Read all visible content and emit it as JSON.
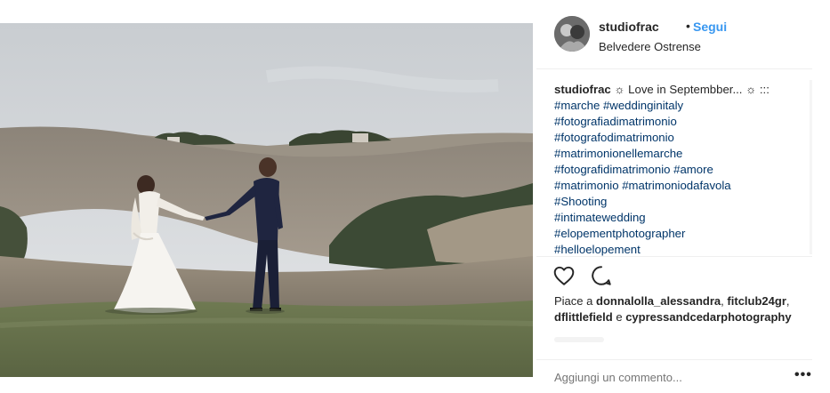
{
  "post": {
    "username": "studiofrac",
    "separator": "•",
    "follow_label": "Segui",
    "location": "Belvedere Ostrense"
  },
  "caption": {
    "user": "studiofrac",
    "first_line_text": "☼ Love in Septembber... ☼ :::",
    "lines": [
      "#marche #weddinginitaly",
      "#fotografiadimatrimonio",
      "#fotografodimatrimonio",
      "#matrimonionellemarche",
      "#fotografidimatrimonio #amore",
      "#matrimonio #matrimoniodafavola",
      "#Shooting",
      "#intimatewedding",
      "#elopementphotographer",
      "#helloelopement"
    ]
  },
  "likes": {
    "prefix": "Piace a",
    "user1": "donnalolla_alessandra",
    "comma": ",",
    "user2": "fitclub24gr",
    "user3": "dflittlefield",
    "conj": "e",
    "user4": "cypressandcedarphotography"
  },
  "comment": {
    "placeholder": "Aggiungi un commento...",
    "more_label": "•••"
  },
  "icons": {
    "like": "heart-icon",
    "comment": "comment-icon"
  },
  "colors": {
    "link_blue": "#3897f0",
    "text": "#262626",
    "placeholder": "#999999",
    "border": "#efefef"
  }
}
